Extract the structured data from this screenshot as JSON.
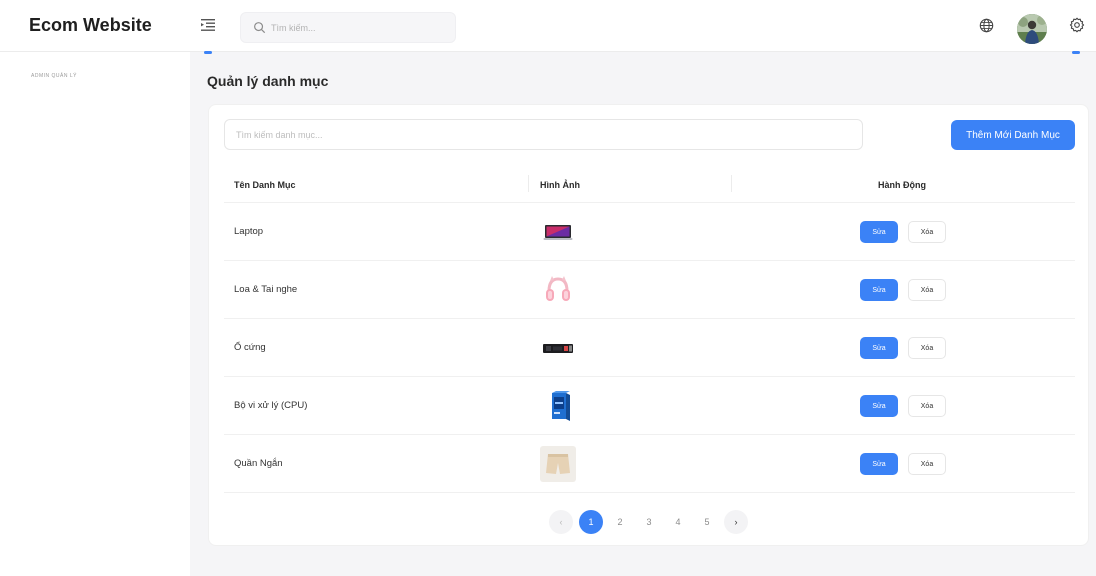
{
  "header": {
    "brand": "Ecom Website",
    "search_placeholder": "Tìm kiếm..."
  },
  "sidebar": {
    "section_label": "ADMIN QUẢN LÝ"
  },
  "page": {
    "title": "Quản lý danh mục"
  },
  "toolbar": {
    "search_placeholder": "Tìm kiếm danh mục...",
    "add_label": "Thêm Mới Danh Mục"
  },
  "table": {
    "headers": {
      "name": "Tên Danh Mục",
      "image": "Hình Ảnh",
      "actions": "Hành Động"
    },
    "rows": [
      {
        "name": "Laptop",
        "image": "laptop",
        "edit": "Sửa",
        "delete": "Xóa"
      },
      {
        "name": "Loa & Tai nghe",
        "image": "headphones",
        "edit": "Sửa",
        "delete": "Xóa"
      },
      {
        "name": "Ổ cứng",
        "image": "ssd",
        "edit": "Sửa",
        "delete": "Xóa"
      },
      {
        "name": "Bộ vi xử lý (CPU)",
        "image": "cpu-box",
        "edit": "Sửa",
        "delete": "Xóa"
      },
      {
        "name": "Quần Ngắn",
        "image": "shorts",
        "edit": "Sửa",
        "delete": "Xóa"
      }
    ]
  },
  "pagination": {
    "pages": [
      "1",
      "2",
      "3",
      "4",
      "5"
    ],
    "current": "1",
    "prev": "‹",
    "next": "›"
  },
  "colors": {
    "accent": "#3b82f6"
  }
}
